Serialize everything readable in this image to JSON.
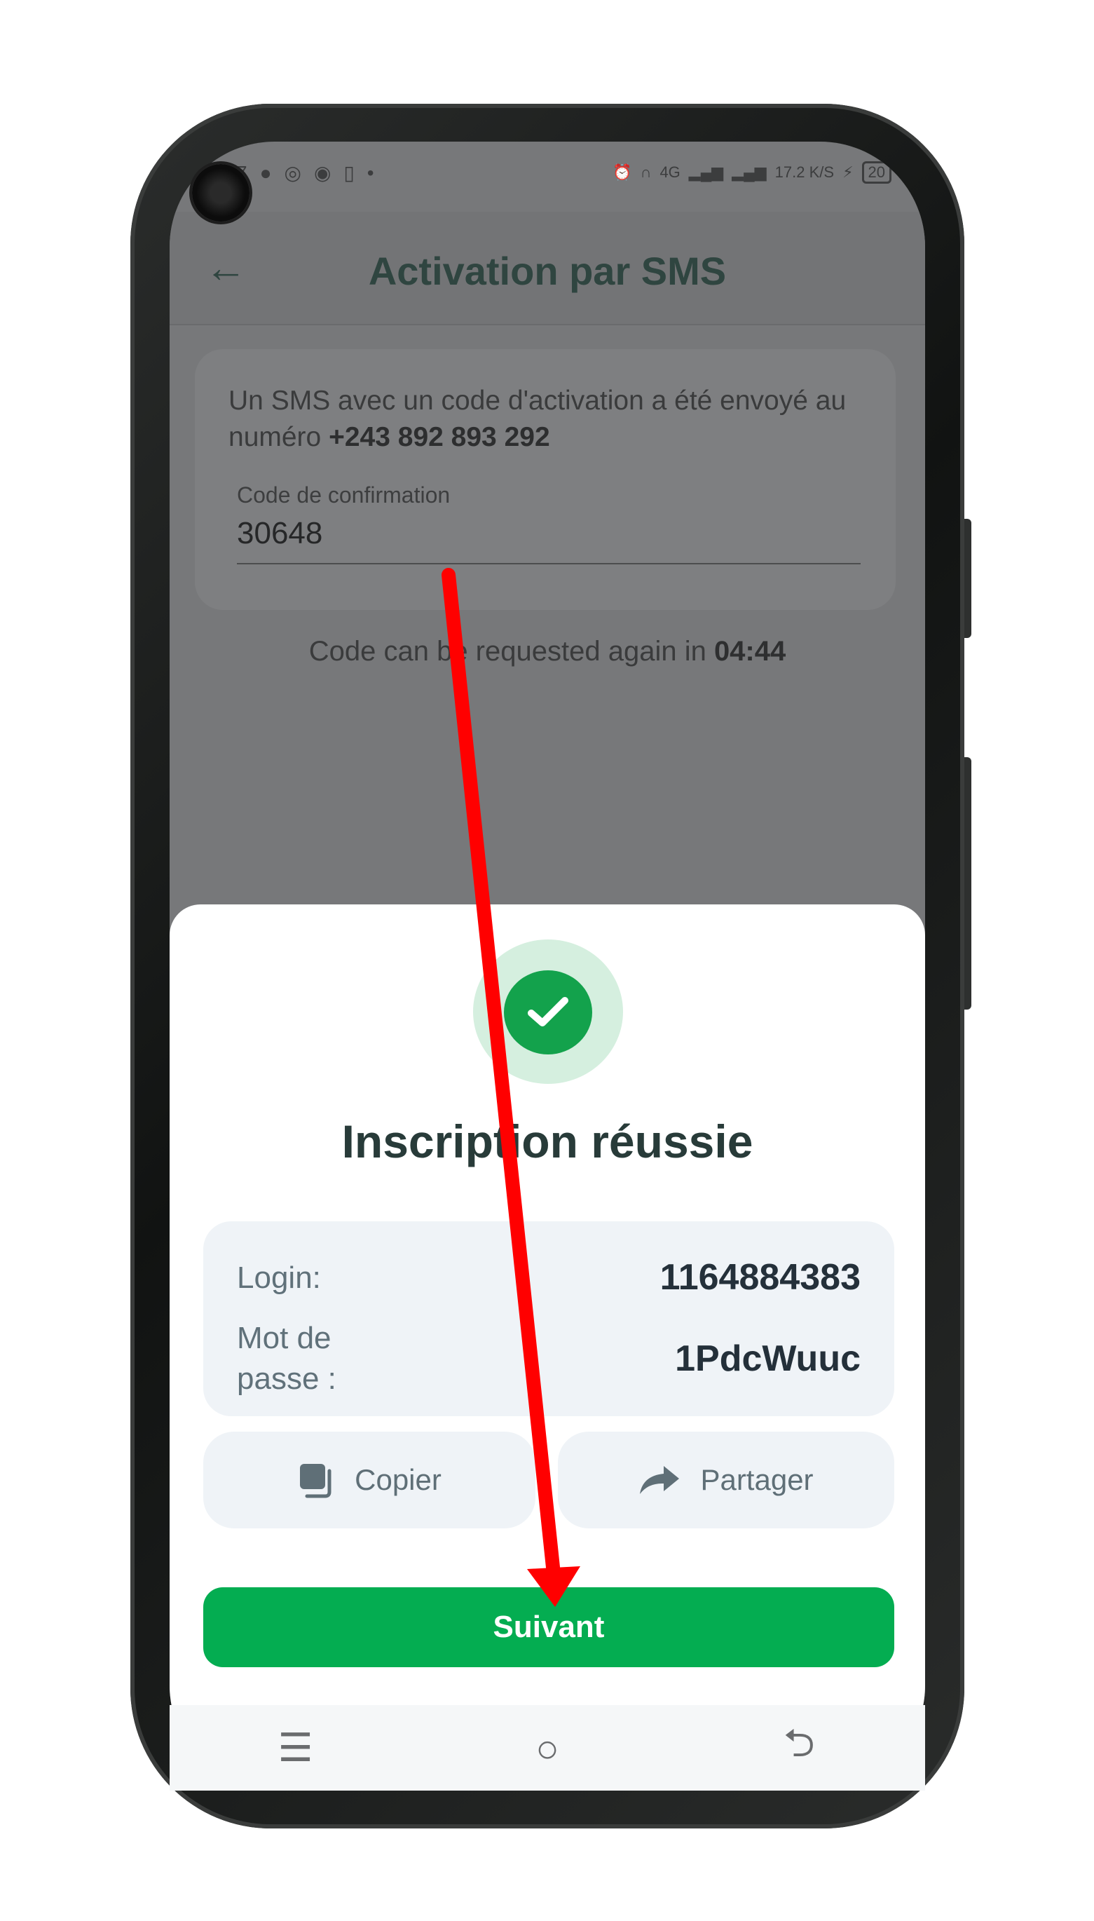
{
  "status_bar": {
    "time": "7",
    "notif_icons": [
      "message-icon",
      "whatsapp-icon",
      "app-icon",
      "sim-icon"
    ],
    "dot": "•",
    "network": "4G",
    "speed": "17.2 K/S",
    "battery": "20"
  },
  "appbar": {
    "back_icon": "←",
    "title": "Activation par SMS"
  },
  "sms_card": {
    "message": "Un SMS avec un code d'activation a été envoyé au numéro ",
    "phone": "+243 892 893 292",
    "field_label": "Code de confirmation",
    "field_value": "30648"
  },
  "resend": {
    "text": "Code can be requested again in ",
    "countdown": "04:44"
  },
  "sheet": {
    "title": "Inscription réussie",
    "login_label": "Login:",
    "login_value": "1164884383",
    "password_label_1": "Mot de",
    "password_label_2": "passe :",
    "password_value": "1PdcWuuc",
    "copy_label": "Copier",
    "share_label": "Partager",
    "next_label": "Suivant"
  },
  "navbar": {
    "menu": "☰",
    "home": "○",
    "back": "⮌"
  },
  "colors": {
    "accent_green": "#04ad51",
    "annotation_red": "#ff0000"
  }
}
